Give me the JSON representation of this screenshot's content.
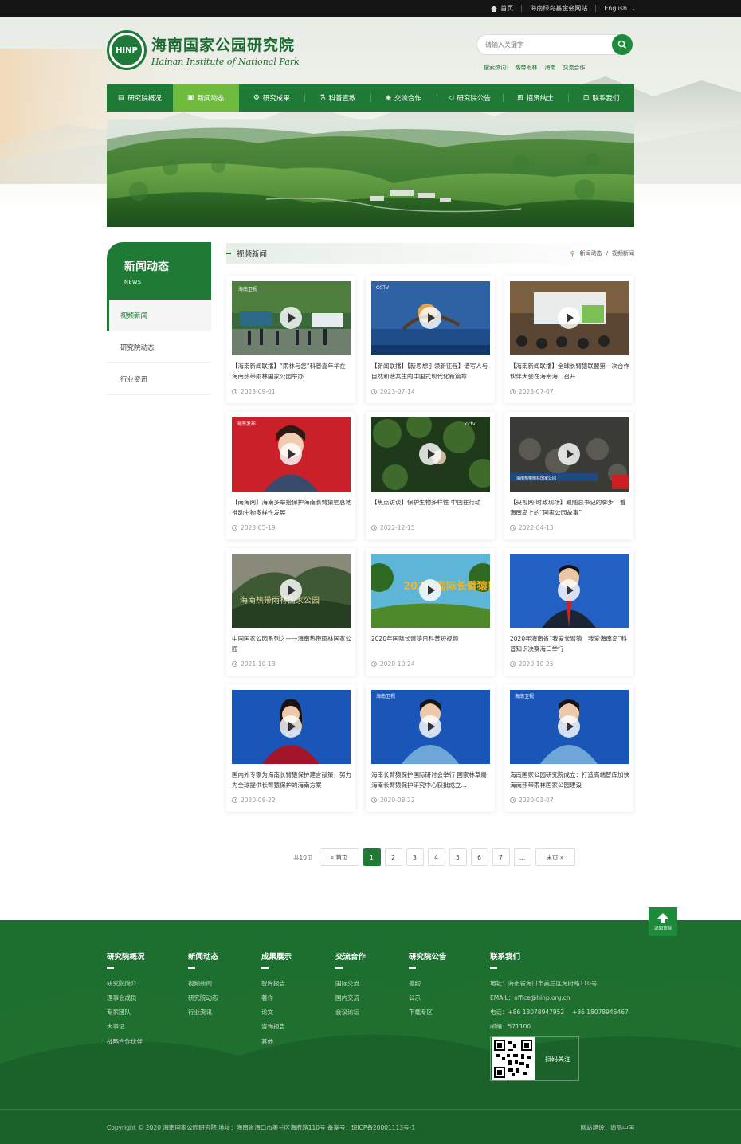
{
  "topbar": {
    "home": "首页",
    "foundation": "海南绿岛基金会网站",
    "lang": "English"
  },
  "logo": {
    "badge": "HINP",
    "cn": "海南国家公园研究院",
    "en": "Hainan Institute of National Park"
  },
  "search": {
    "placeholder": "请输入关键字",
    "hot_label": "搜索热词:",
    "hot_words": [
      "热带雨林",
      "海南",
      "交流合作"
    ]
  },
  "nav": [
    {
      "label": "研究院概况",
      "icon": "building-icon"
    },
    {
      "label": "新闻动态",
      "icon": "news-icon"
    },
    {
      "label": "研究成果",
      "icon": "gear-icon"
    },
    {
      "label": "科普宣教",
      "icon": "science-icon"
    },
    {
      "label": "交流合作",
      "icon": "handshake-icon"
    },
    {
      "label": "研究院公告",
      "icon": "megaphone-icon"
    },
    {
      "label": "招贤纳士",
      "icon": "recruit-icon"
    },
    {
      "label": "联系我们",
      "icon": "contact-icon"
    }
  ],
  "nav_active": 1,
  "sidebar": {
    "title": "新闻动态",
    "subtitle": "NEWS",
    "items": [
      "视频新闻",
      "研究院动态",
      "行业资讯"
    ],
    "active": 0
  },
  "content": {
    "title": "视频新闻",
    "breadcrumb": [
      "新闻动态",
      "视频新闻"
    ],
    "breadcrumb_sep": "/"
  },
  "cards": [
    {
      "title": "【海南新闻联播】“雨林与您”科普嘉年华在海南热带雨林国家公园举办",
      "date": "2023-09-01"
    },
    {
      "title": "【新闻联播】【新思想引领新征程】谱写人与自然和谐共生的中国式现代化新篇章",
      "date": "2023-07-14"
    },
    {
      "title": "【海南新闻联播】全球长臂猿联盟第一次合作伙伴大会在海南海口召开",
      "date": "2023-07-07"
    },
    {
      "title": "【南海网】海南多举措保护海南长臂猿栖息地 推动生物多样性发展",
      "date": "2023-05-19"
    },
    {
      "title": "【焦点访谈】保护生物多样性 中国在行动",
      "date": "2022-12-15"
    },
    {
      "title": "【央视网-时政现场】跟随总书记的脚步　看海南岛上的“国家公园故事”",
      "date": "2022-04-13"
    },
    {
      "title": "中国国家公园系列之——海南热带雨林国家公园",
      "date": "2021-10-13"
    },
    {
      "title": "2020年国际长臂猿日科普短视频",
      "date": "2020-10-24"
    },
    {
      "title": "2020年海南省“我爱长臂猿　我爱海南岛”科普知识决赛海口举行",
      "date": "2020-10-25"
    },
    {
      "title": "国内外专家为海南长臂猿保护建言献策，努力为全球提供长臂猿保护的海南方案",
      "date": "2020-08-22"
    },
    {
      "title": "海南长臂猿保护国际研讨会举行 国家林草局海南长臂猿保护研究中心获批成立...",
      "date": "2020-08-22"
    },
    {
      "title": "海南国家公园研究院成立：打造高端智库加快海南热带雨林国家公园建设",
      "date": "2020-01-07"
    }
  ],
  "thumb_texts": {
    "t0": "海南卫视",
    "t1": "CCTV",
    "t3": "海南发布",
    "t4": "cctv",
    "t6": "海南热带雨林国家公园",
    "t7": "2020 国际长臂猿日",
    "t5": "海南热带雨林国家公园"
  },
  "pager": {
    "total": "共10页",
    "first": "首页",
    "pages": [
      "1",
      "2",
      "3",
      "4",
      "5",
      "6",
      "7",
      "..."
    ],
    "last": "末页",
    "active": 0
  },
  "back_to_top": "返回顶部",
  "footer": {
    "cols": [
      {
        "title": "研究院概况",
        "items": [
          "研究院简介",
          "理事会成员",
          "专家团队",
          "大事记",
          "战略合作伙伴"
        ]
      },
      {
        "title": "新闻动态",
        "items": [
          "视频新闻",
          "研究院动态",
          "行业资讯"
        ]
      },
      {
        "title": "成果展示",
        "items": [
          "智库报告",
          "著作",
          "论文",
          "咨询报告",
          "其他"
        ]
      },
      {
        "title": "交流合作",
        "items": [
          "国际交流",
          "国内交流",
          "会议论坛"
        ]
      },
      {
        "title": "研究院公告",
        "items": [
          "邀约",
          "公示",
          "下载专区"
        ]
      }
    ],
    "contact": {
      "title": "联系我们",
      "address": "地址：海南省海口市美兰区海府路110号",
      "email": "EMAIL：office@hinp.org.cn",
      "phone": "电话：+86 18078947952　 +86 18078946467",
      "zip": "邮编：571100",
      "qr_label": "扫码关注"
    },
    "copyright": "Copyright © 2020 海南国家公园研究院 地址：海南省海口市美兰区海府路110号 备案号：琼ICP备20001113号-1",
    "built_by": "网站建设：尚品中国"
  },
  "colors": {
    "brand": "#1e7a34",
    "active_nav": "#6fbb3e",
    "footer": "#1c6f2e"
  }
}
